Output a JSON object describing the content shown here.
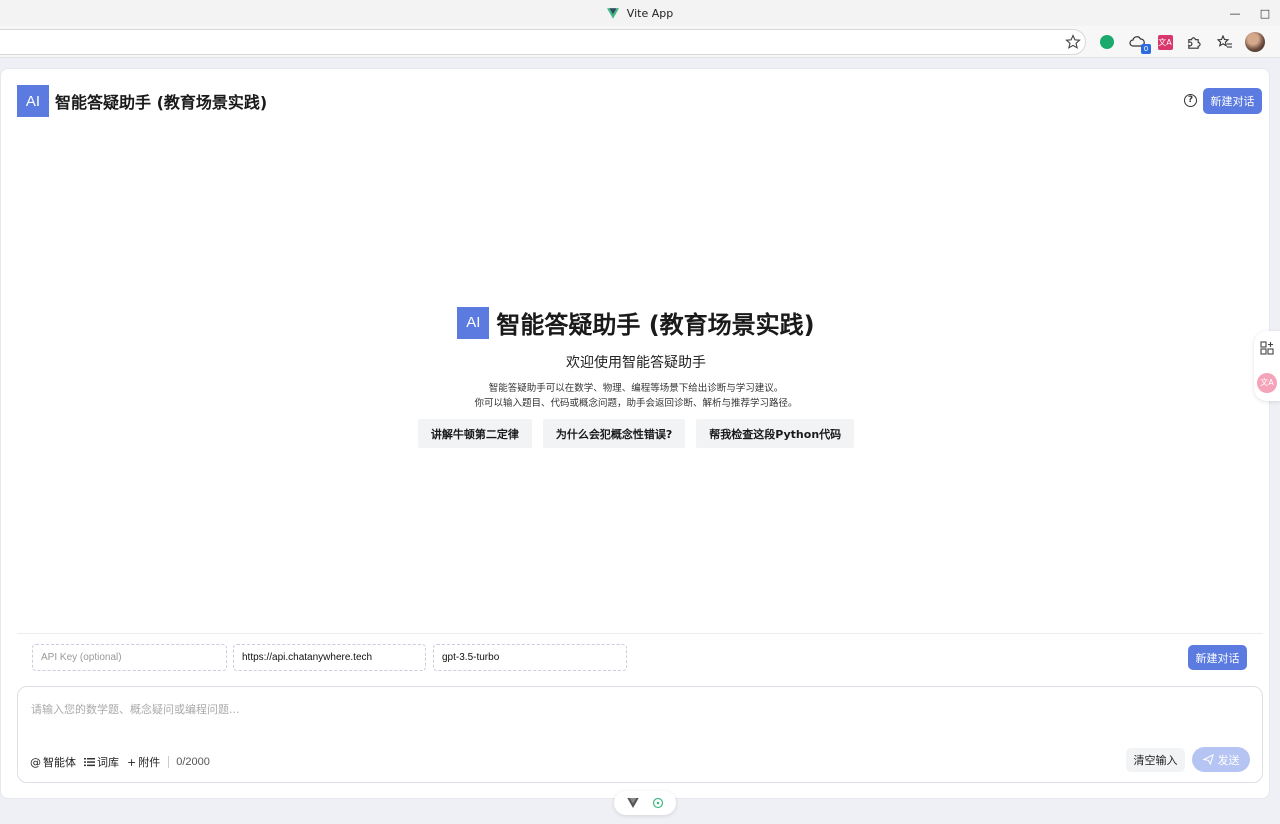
{
  "browser": {
    "tab_title": "Vite App",
    "minimize": "—",
    "close": "□",
    "badge_count": "0",
    "translate_ext": "文A"
  },
  "header": {
    "ai_badge": "AI",
    "title": "智能答疑助手 (教育场景实践)",
    "help": "?",
    "new_chat": "新建对话"
  },
  "welcome": {
    "ai_badge": "AI",
    "title": "智能答疑助手 (教育场景实践)",
    "subtitle": "欢迎使用智能答疑助手",
    "desc_line1": "智能答疑助手可以在数学、物理、编程等场景下给出诊断与学习建议。",
    "desc_line2": "你可以输入题目、代码或概念问题，助手会返回诊断、解析与推荐学习路径。",
    "suggestions": [
      "讲解牛顿第二定律",
      "为什么会犯概念性错误?",
      "帮我检查这段Python代码"
    ]
  },
  "config": {
    "api_key_placeholder": "API Key (optional)",
    "base_url": "https://api.chatanywhere.tech",
    "model": "gpt-3.5-turbo",
    "new_chat": "新建对话"
  },
  "composer": {
    "placeholder": "请输入您的数学题、概念疑问或编程问题...",
    "agent_label": "智能体",
    "lexicon_label": "词库",
    "attach_label": "附件",
    "char_count": "0/2000",
    "clear_label": "清空输入",
    "send_label": "发送"
  },
  "side": {
    "translate": "文A"
  },
  "colors": {
    "accent": "#5b7be0",
    "send_disabled": "#b6c4f3"
  }
}
